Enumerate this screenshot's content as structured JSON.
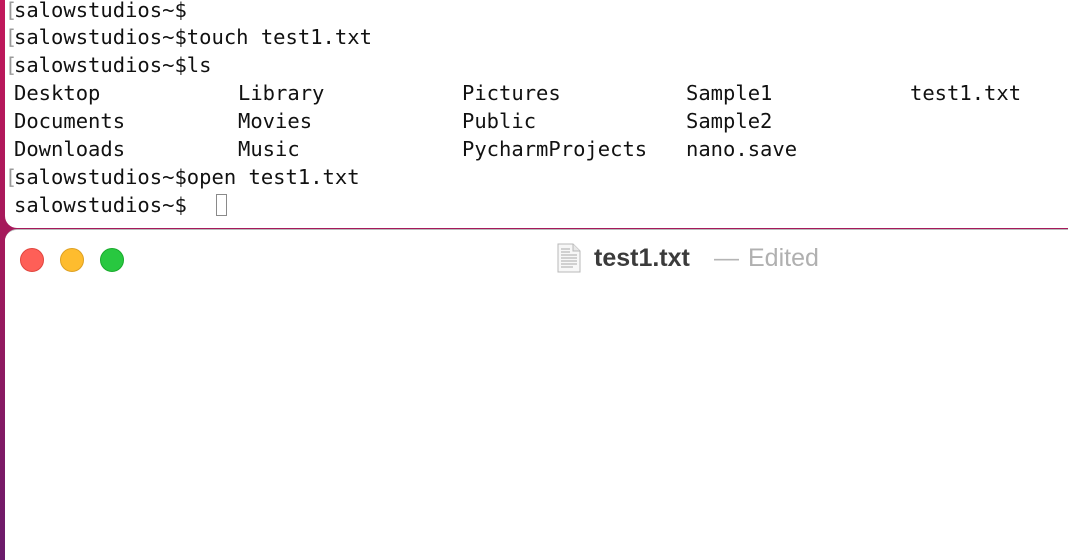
{
  "terminal": {
    "lines": [
      "salowstudios~$",
      "salowstudios~$touch test1.txt",
      "salowstudios~$ls",
      "salowstudios~$open test1.txt",
      "salowstudios~$"
    ],
    "ls_output": [
      [
        "Desktop",
        "Library",
        "Pictures",
        "Sample1",
        "test1.txt"
      ],
      [
        "Documents",
        "Movies",
        "Public",
        "Sample2"
      ],
      [
        "Downloads",
        "Music",
        "PycharmProjects",
        "nano.save"
      ]
    ]
  },
  "editor": {
    "filename": "test1.txt",
    "separator": "—",
    "status": "Edited",
    "icon": "text-document-icon",
    "content": ""
  },
  "colors": {
    "close": "#fe5f57",
    "minimize": "#febc2e",
    "zoom": "#28c840",
    "desktop": "#c2185b"
  }
}
